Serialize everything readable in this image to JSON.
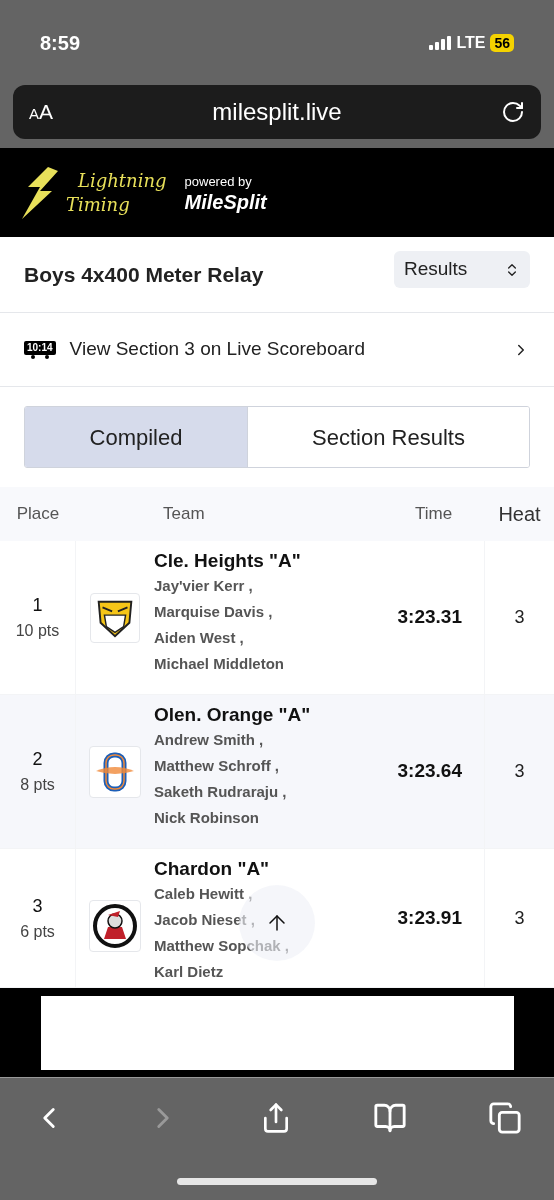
{
  "status_bar": {
    "time": "8:59",
    "network": "LTE",
    "battery": "56"
  },
  "browser": {
    "reader_small": "A",
    "reader_large": "A",
    "url": "milesplit.live"
  },
  "site_header": {
    "brand_line1": "Lightning",
    "brand_line2": "Timing",
    "powered_by": "powered by",
    "partner": "MileSplit"
  },
  "event": {
    "title": "Boys 4x400 Meter Relay",
    "view_select": "Results"
  },
  "scoreboard_link": {
    "clock": "10:14",
    "label": "View Section 3 on Live Scoreboard"
  },
  "tabs": [
    {
      "label": "Compiled",
      "selected": true
    },
    {
      "label": "Section Results",
      "selected": false
    }
  ],
  "table": {
    "columns": [
      "Place",
      "Team",
      "Time",
      "Heat"
    ],
    "rows": [
      {
        "place": "1",
        "points": "10 pts",
        "team": "Cle. Heights \"A\"",
        "athletes": [
          "Jay'vier Kerr ,",
          "Marquise Davis ,",
          "Aiden West ,",
          "Michael Middleton"
        ],
        "time": "3:23.31",
        "heat": "3",
        "logo": {
          "kind": "tiger"
        }
      },
      {
        "place": "2",
        "points": "8 pts",
        "team": "Olen. Orange \"A\"",
        "athletes": [
          "Andrew Smith ,",
          "Matthew Schroff ,",
          "Saketh Rudraraju ,",
          "Nick Robinson"
        ],
        "time": "3:23.64",
        "heat": "3",
        "logo": {
          "kind": "letter"
        }
      },
      {
        "place": "3",
        "points": "6 pts",
        "team": "Chardon \"A\"",
        "athletes": [
          "Caleb Hewitt ,",
          "Jacob Nieset ,",
          "Matthew Sopchak ,",
          "Karl Dietz"
        ],
        "time": "3:23.91",
        "heat": "3",
        "logo": {
          "kind": "round"
        }
      }
    ]
  }
}
